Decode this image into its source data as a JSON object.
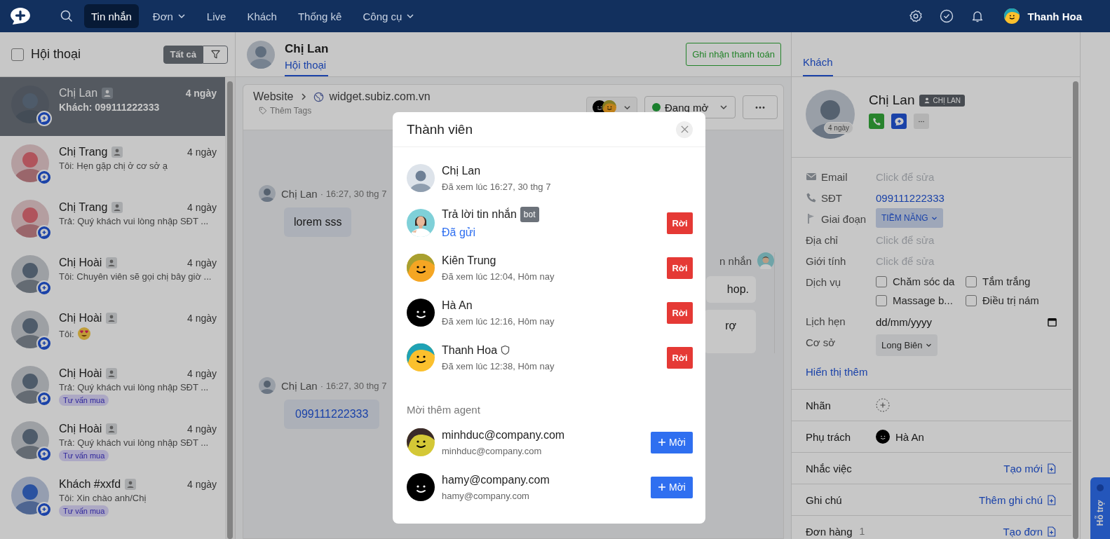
{
  "nav": {
    "items": [
      {
        "label": "Tin nhắn",
        "selected": true,
        "caret": false
      },
      {
        "label": "Đơn",
        "selected": false,
        "caret": true
      },
      {
        "label": "Live",
        "selected": false,
        "caret": false
      },
      {
        "label": "Khách",
        "selected": false,
        "caret": false
      },
      {
        "label": "Thống kê",
        "selected": false,
        "caret": false
      },
      {
        "label": "Công cụ",
        "selected": false,
        "caret": true
      }
    ],
    "user": "Thanh Hoa"
  },
  "inbox": {
    "title": "Hội thoại",
    "checked": false,
    "filter": "Tất cả",
    "filter_selected": true
  },
  "conversations": [
    {
      "name": "Chị Lan",
      "time": "4 ngày",
      "preview": "Khách: 099111222333",
      "selected": true,
      "color": "#4e5b6a",
      "emoji": false
    },
    {
      "name": "Chị Trang",
      "time": "4 ngày",
      "preview": "Tôi: Hẹn gặp chị ở cơ sở ạ",
      "selected": false,
      "color": "#b0545c",
      "emoji": false
    },
    {
      "name": "Chị Trang",
      "time": "4 ngày",
      "preview": "Trả: Quý khách vui lòng nhập SĐT ...",
      "selected": false,
      "color": "#b0545c",
      "emoji": false
    },
    {
      "name": "Chị Hoài",
      "time": "4 ngày",
      "preview": "Tôi: Chuyên viên sẽ gọi chị bây giờ ...",
      "selected": false,
      "color": "#4e5b6a",
      "emoji": false
    },
    {
      "name": "Chị Hoài",
      "time": "4 ngày",
      "preview": "Tôi:",
      "selected": false,
      "color": "#4e5b6a",
      "emoji": true
    },
    {
      "name": "Chị Hoài",
      "time": "4 ngày",
      "preview": "Trả: Quý khách vui lòng nhập SĐT ...",
      "tag": "Tư vấn mua",
      "selected": false,
      "color": "#4e5b6a",
      "emoji": false
    },
    {
      "name": "Chị Hoài",
      "time": "4 ngày",
      "preview": "Trả: Quý khách vui lòng nhập SĐT ...",
      "tag": "Tư vấn mua",
      "selected": false,
      "color": "#4e5b6a",
      "emoji": false
    },
    {
      "name": "Khách #xxfd",
      "time": "4 ngày",
      "preview": "Tôi: Xin chào anh/Chị",
      "tag": "Tư vấn mua",
      "selected": false,
      "color": "#2a52a0",
      "emoji": false
    }
  ],
  "chat": {
    "contact": "Chị Lan",
    "tabs": [
      {
        "label": "Hội thoại",
        "selected": true
      }
    ],
    "payment_button": "Ghi nhận thanh toán",
    "channel": "Website",
    "url": "widget.subiz.com.vn",
    "add_tags": "Thêm Tags",
    "status": "Đang mở",
    "messages": [
      {
        "kind": "incoming",
        "author": "Chị Lan",
        "time": "· 16:27, 30 thg 7",
        "bubbles": [
          {
            "text": "lorem sss",
            "kind": "text"
          }
        ]
      },
      {
        "kind": "outgoing",
        "author": "n nhắn",
        "bubbles": [
          {
            "text": "hop.",
            "kind": "text"
          },
          {
            "text": "rợ",
            "kind": "tall"
          }
        ]
      },
      {
        "kind": "incoming",
        "author": "Chị Lan",
        "time": "· 16:27, 30 thg 7",
        "bubbles": [
          {
            "text": "099111222333",
            "kind": "link"
          }
        ]
      }
    ]
  },
  "customer": {
    "tabs": [
      {
        "label": "Khách",
        "selected": true
      }
    ],
    "name": "Chị Lan",
    "badge": "CHỊ LAN",
    "seen": "4 ngày",
    "fields": [
      {
        "label": "Email",
        "has_icon": true,
        "kind": "empty",
        "placeholder": "Click để sửa"
      },
      {
        "label": "SĐT",
        "has_icon": true,
        "kind": "link",
        "value": "099111222333"
      },
      {
        "label": "Giai đoạn",
        "has_icon": true,
        "kind": "stage",
        "value": "TIỀM NĂNG"
      },
      {
        "label": "Địa chỉ",
        "has_icon": false,
        "kind": "empty",
        "placeholder": "Click để sửa"
      },
      {
        "label": "Giới tính",
        "has_icon": false,
        "kind": "empty",
        "placeholder": "Click để sửa"
      },
      {
        "label": "Dịch vụ",
        "has_icon": false,
        "kind": "checkboxes",
        "options": [
          {
            "label": "Chăm sóc da",
            "checked": false
          },
          {
            "label": "Tắm trắng",
            "checked": false
          },
          {
            "label": "Massage b...",
            "checked": false
          },
          {
            "label": "Điều trị nám",
            "checked": false
          }
        ]
      },
      {
        "label": "Lịch hẹn",
        "has_icon": false,
        "kind": "date",
        "value": "dd/mm/yyyy"
      },
      {
        "label": "Cơ sở",
        "has_icon": false,
        "kind": "select",
        "value": "Long Biên"
      }
    ],
    "show_more": "Hiển thị thêm",
    "sections": [
      {
        "label": "Nhãn",
        "kind": "add"
      },
      {
        "label": "Phụ trách",
        "kind": "assignee",
        "value": "Hà An"
      },
      {
        "label": "Nhắc việc",
        "kind": "action",
        "value": "Tạo mới"
      },
      {
        "label": "Ghi chú",
        "kind": "action",
        "value": "Thêm ghi chú"
      },
      {
        "label": "Đơn hàng",
        "kind": "action",
        "count": "1",
        "value": "Tạo đơn"
      }
    ]
  },
  "support_tab": "Hỗ trợ",
  "modal": {
    "title": "Thành viên",
    "members": [
      {
        "name": "Chị Lan",
        "status": "Đã xem lúc 16:27, 30 thg 7",
        "kind": "customer",
        "color": "#6e8096",
        "admin": false
      },
      {
        "name": "Trả lời tin nhắn",
        "badge": "bot",
        "status": "Đã gửi",
        "kind": "bot",
        "color": "#7fd0d8",
        "admin": false,
        "leave": "Rời"
      },
      {
        "name": "Kiên Trung",
        "status": "Đã xem lúc 12:04, Hôm nay",
        "kind": "agent",
        "color": "#f5a623",
        "hair": {
          "color": "#a8a030"
        },
        "admin": false,
        "leave": "Rời"
      },
      {
        "name": "Hà An",
        "status": "Đã xem lúc 12:16, Hôm nay",
        "kind": "agent",
        "color": "#000000",
        "admin": false,
        "leave": "Rời"
      },
      {
        "name": "Thanh Hoa",
        "status": "Đã xem lúc 12:38, Hôm nay",
        "kind": "agent",
        "color": "#fbc02d",
        "hair": {
          "color": "#1fa2b5"
        },
        "admin": true,
        "leave": "Rời"
      }
    ],
    "invite_heading": "Mời thêm agent",
    "invites": [
      {
        "name": "minhduc@company.com",
        "email": "minhduc@company.com",
        "color": "#d4c836",
        "hair": {
          "color": "#3a2a2a"
        },
        "button": "Mời"
      },
      {
        "name": "hamy@company.com",
        "email": "hamy@company.com",
        "color": "#000000",
        "button": "Mời"
      }
    ]
  }
}
